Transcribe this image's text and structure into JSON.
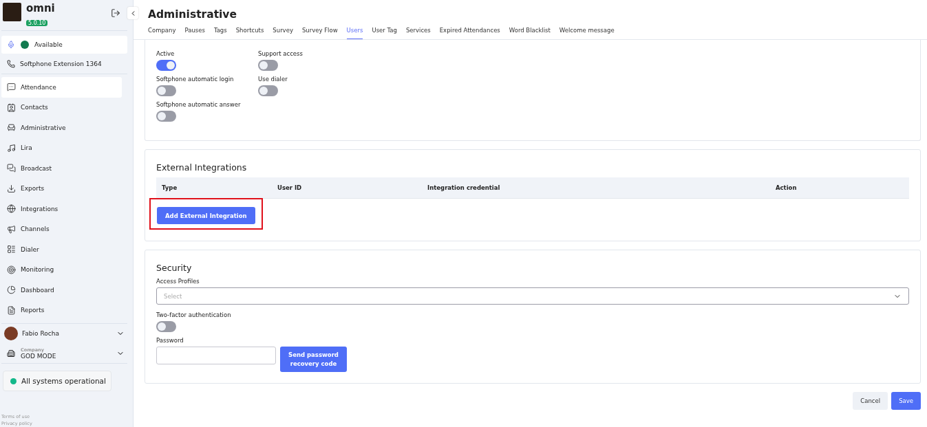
{
  "app": {
    "name": "omni",
    "version": "5.0.10"
  },
  "status": {
    "label": "Available",
    "color": "#127a4f"
  },
  "extension": "Softphone Extension 1364",
  "nav": [
    {
      "label": "Attendance",
      "selected": true
    },
    {
      "label": "Contacts",
      "selected": false
    },
    {
      "label": "Administrative",
      "selected": false
    },
    {
      "label": "Lira",
      "selected": false
    },
    {
      "label": "Broadcast",
      "selected": false
    },
    {
      "label": "Exports",
      "selected": false
    },
    {
      "label": "Integrations",
      "selected": false
    },
    {
      "label": "Channels",
      "selected": false
    },
    {
      "label": "Dialer",
      "selected": false
    },
    {
      "label": "Monitoring",
      "selected": false
    },
    {
      "label": "Dashboard",
      "selected": false
    },
    {
      "label": "Reports",
      "selected": false
    }
  ],
  "user": {
    "name": "Fabio Rocha"
  },
  "company": {
    "caption": "Company",
    "name": "GOD MODE"
  },
  "system_status": {
    "label": "All systems operational",
    "color": "#14b88a"
  },
  "footer_links": [
    "Terms of use",
    "Privacy policy"
  ],
  "page_title": "Administrative",
  "tabs": [
    {
      "label": "Company",
      "selected": false
    },
    {
      "label": "Pauses",
      "selected": false
    },
    {
      "label": "Tags",
      "selected": false
    },
    {
      "label": "Shortcuts",
      "selected": false
    },
    {
      "label": "Survey",
      "selected": false
    },
    {
      "label": "Survey Flow",
      "selected": false
    },
    {
      "label": "Users",
      "selected": true
    },
    {
      "label": "User Tag",
      "selected": false
    },
    {
      "label": "Services",
      "selected": false
    },
    {
      "label": "Expired Attendances",
      "selected": false
    },
    {
      "label": "Word Blacklist",
      "selected": false
    },
    {
      "label": "Welcome message",
      "selected": false
    }
  ],
  "configuration": {
    "columns": [
      [
        {
          "label": "Active",
          "on": true
        },
        {
          "label": "Softphone automatic login",
          "on": false
        },
        {
          "label": "Softphone automatic answer",
          "on": false
        }
      ],
      [
        {
          "label": "Support access",
          "on": false
        },
        {
          "label": "Use dialer",
          "on": false
        }
      ]
    ]
  },
  "external_integrations": {
    "title": "External Integrations",
    "columns": [
      "Type",
      "User ID",
      "Integration credential",
      "Action"
    ],
    "add_button": {
      "label": "Add External Integration",
      "highlighted": true
    }
  },
  "security": {
    "title": "Security",
    "access_profiles": {
      "label": "Access Profiles",
      "placeholder": "Select"
    },
    "two_factor": {
      "label": "Two-factor authentication",
      "on": false
    },
    "password": {
      "label": "Password",
      "button": "Send password recovery code"
    }
  },
  "actions": [
    "Cancel",
    "Save"
  ]
}
